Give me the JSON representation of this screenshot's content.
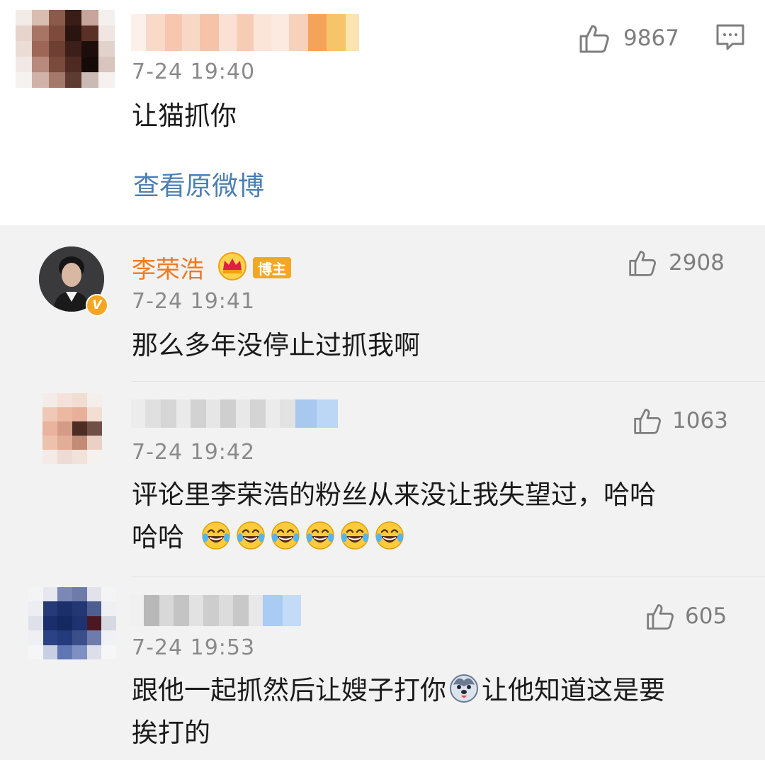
{
  "top_comment": {
    "time": "7-24 19:40",
    "text": "让猫抓你",
    "likes": "9867",
    "view_original": "查看原微博"
  },
  "replies": [
    {
      "username": "李荣浩",
      "badge": "博主",
      "time": "7-24 19:41",
      "text": "那么多年没停止过抓我啊",
      "likes": "2908",
      "verified_mark": "V"
    },
    {
      "time": "7-24 19:42",
      "text_line1": "评论里李荣浩的粉丝从来没让我失望过，哈哈",
      "text_line2": "哈哈",
      "likes": "1063",
      "emoji_count": 6
    },
    {
      "time": "7-24 19:53",
      "text_line1a": "跟他一起抓然后让嫂子打你",
      "text_line1b": "让他知道这是要",
      "text_line2": "挨打的",
      "likes": "605"
    }
  ],
  "colors": {
    "username": "#f07a1f",
    "link": "#4d7fb3",
    "muted": "#8a8a8a",
    "reply_bg": "#f2f2f2"
  },
  "icons": [
    "thumbs-up-icon",
    "comment-icon",
    "crown-icon",
    "verified-icon",
    "laugh-cry-emoji",
    "husky-emoji"
  ]
}
